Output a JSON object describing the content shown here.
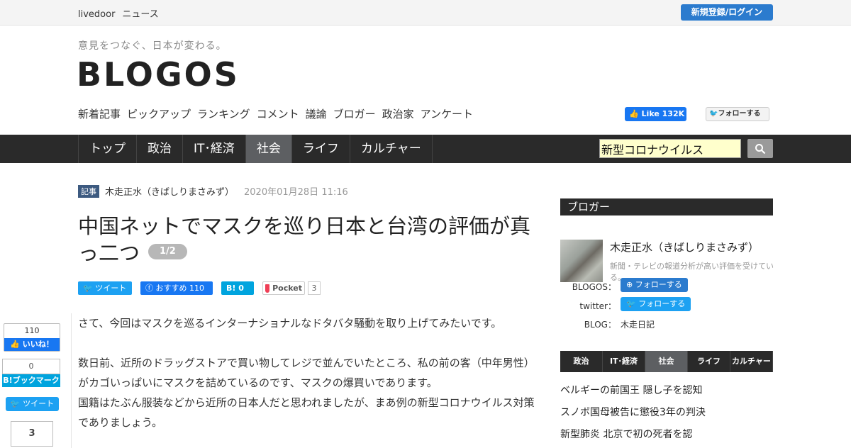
{
  "topbar": {
    "brand_a": "livedoor",
    "brand_b": "ニュース",
    "login_label": "新規登録/ログイン"
  },
  "header": {
    "tagline": "意見をつなぐ、日本が変わる。",
    "logo": "BLOGOS",
    "subnav": [
      "新着記事",
      "ピックアップ",
      "ランキング",
      "コメント",
      "議論",
      "ブロガー",
      "政治家",
      "アンケート"
    ],
    "fb_like": "Like 132K",
    "tw_follow": "フォローする"
  },
  "mainnav": {
    "items": [
      "トップ",
      "政治",
      "IT･経済",
      "社会",
      "ライフ",
      "カルチャー"
    ],
    "active": "社会",
    "search_value": "新型コロナウイルス"
  },
  "article": {
    "tag": "記事",
    "author": "木走正水（きばしりまさみず）",
    "date": "2020年01月28日 11:16",
    "title": "中国ネットでマスクを巡り日本と台湾の評価が真っ二つ",
    "page": "1/2",
    "share": {
      "tweet": "ツイート",
      "fb": "おすすめ 110",
      "hb": "0",
      "pocket": "Pocket",
      "pocket_count": "3"
    },
    "paragraphs": [
      "さて、今回はマスクを巡るインターナショナルなドタバタ騒動を取り上げてみたいです。",
      "数日前、近所のドラッグストアで買い物してレジで並んでいたところ、私の前の客（中年男性）がカゴいっぱいにマスクを詰めているのです、マスクの爆買いであります。",
      "国籍はたぶん服装などから近所の日本人だと思われましたが、まあ例の新型コロナウイルス対策でありましょう。"
    ]
  },
  "floatbar": {
    "fb_count": "110",
    "fb_label": "いいね！",
    "hb_count": "0",
    "hb_label": "ブックマーク",
    "tweet": "ツイート",
    "pocket_count": "3"
  },
  "sidebar": {
    "heading": "ブロガー",
    "blogger_name": "木走正水（きばしりまさみず）",
    "blogger_desc": "新聞・テレビの報道分析が高い評価を受けている。",
    "blogos_label": "BLOGOS：",
    "blogos_follow": "フォローする",
    "twitter_label": "twitter：",
    "twitter_follow": "フォローする",
    "blog_label": "BLOG：",
    "blog_value": "木走日記",
    "tabs": [
      "政治",
      "IT･経済",
      "社会",
      "ライフ",
      "カルチャー"
    ],
    "active_tab": "社会",
    "news": [
      "ベルギーの前国王 隠し子を認知",
      "スノボ国母被告に懲役3年の判決",
      "新型肺炎 北京で初の死者を認"
    ]
  },
  "colors": {
    "accent": "#2b7bce",
    "nav_bg": "#2a2a2a",
    "nav_active": "#5d5f62",
    "facebook": "#1877f2",
    "twitter": "#1da1f2",
    "hatena": "#00a4de"
  }
}
